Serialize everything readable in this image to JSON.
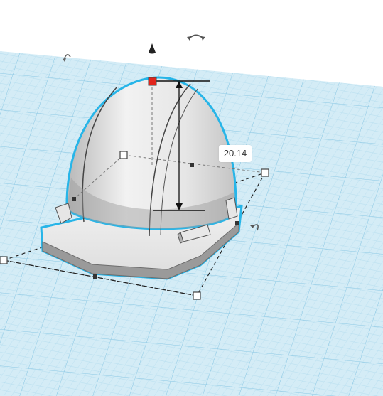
{
  "workplane": {
    "background_color": "#ffffff",
    "grid_fill_color": "#d4ecf6",
    "grid_minor_color": "#a9d7ec",
    "grid_major_color": "#88c6e3"
  },
  "selection": {
    "outline_color": "#27b5e8",
    "handle_fill": "#ffffff",
    "handle_stroke": "#444444",
    "top_handle_color": "#e0241b"
  },
  "shape": {
    "icon": "dome-shape",
    "fill_color": "#e5e5e5",
    "shadow_color": "#8c8c8c"
  },
  "dimension": {
    "height_value": "20.14"
  },
  "controls": {
    "rotate_top_icon": "rotate-arrow-icon",
    "rotate_left_icon": "rotate-arrow-icon",
    "rotate_right_icon": "rotate-arrow-icon",
    "lift_cone_icon": "cone-lift-icon"
  }
}
